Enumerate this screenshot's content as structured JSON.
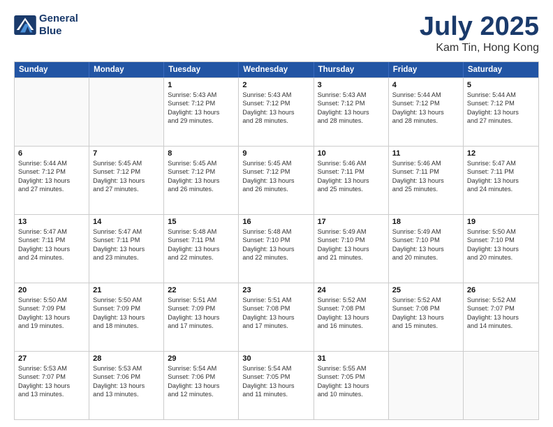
{
  "header": {
    "logo_line1": "General",
    "logo_line2": "Blue",
    "month": "July 2025",
    "location": "Kam Tin, Hong Kong"
  },
  "weekdays": [
    "Sunday",
    "Monday",
    "Tuesday",
    "Wednesday",
    "Thursday",
    "Friday",
    "Saturday"
  ],
  "rows": [
    [
      {
        "day": "",
        "lines": []
      },
      {
        "day": "",
        "lines": []
      },
      {
        "day": "1",
        "lines": [
          "Sunrise: 5:43 AM",
          "Sunset: 7:12 PM",
          "Daylight: 13 hours",
          "and 29 minutes."
        ]
      },
      {
        "day": "2",
        "lines": [
          "Sunrise: 5:43 AM",
          "Sunset: 7:12 PM",
          "Daylight: 13 hours",
          "and 28 minutes."
        ]
      },
      {
        "day": "3",
        "lines": [
          "Sunrise: 5:43 AM",
          "Sunset: 7:12 PM",
          "Daylight: 13 hours",
          "and 28 minutes."
        ]
      },
      {
        "day": "4",
        "lines": [
          "Sunrise: 5:44 AM",
          "Sunset: 7:12 PM",
          "Daylight: 13 hours",
          "and 28 minutes."
        ]
      },
      {
        "day": "5",
        "lines": [
          "Sunrise: 5:44 AM",
          "Sunset: 7:12 PM",
          "Daylight: 13 hours",
          "and 27 minutes."
        ]
      }
    ],
    [
      {
        "day": "6",
        "lines": [
          "Sunrise: 5:44 AM",
          "Sunset: 7:12 PM",
          "Daylight: 13 hours",
          "and 27 minutes."
        ]
      },
      {
        "day": "7",
        "lines": [
          "Sunrise: 5:45 AM",
          "Sunset: 7:12 PM",
          "Daylight: 13 hours",
          "and 27 minutes."
        ]
      },
      {
        "day": "8",
        "lines": [
          "Sunrise: 5:45 AM",
          "Sunset: 7:12 PM",
          "Daylight: 13 hours",
          "and 26 minutes."
        ]
      },
      {
        "day": "9",
        "lines": [
          "Sunrise: 5:45 AM",
          "Sunset: 7:12 PM",
          "Daylight: 13 hours",
          "and 26 minutes."
        ]
      },
      {
        "day": "10",
        "lines": [
          "Sunrise: 5:46 AM",
          "Sunset: 7:11 PM",
          "Daylight: 13 hours",
          "and 25 minutes."
        ]
      },
      {
        "day": "11",
        "lines": [
          "Sunrise: 5:46 AM",
          "Sunset: 7:11 PM",
          "Daylight: 13 hours",
          "and 25 minutes."
        ]
      },
      {
        "day": "12",
        "lines": [
          "Sunrise: 5:47 AM",
          "Sunset: 7:11 PM",
          "Daylight: 13 hours",
          "and 24 minutes."
        ]
      }
    ],
    [
      {
        "day": "13",
        "lines": [
          "Sunrise: 5:47 AM",
          "Sunset: 7:11 PM",
          "Daylight: 13 hours",
          "and 24 minutes."
        ]
      },
      {
        "day": "14",
        "lines": [
          "Sunrise: 5:47 AM",
          "Sunset: 7:11 PM",
          "Daylight: 13 hours",
          "and 23 minutes."
        ]
      },
      {
        "day": "15",
        "lines": [
          "Sunrise: 5:48 AM",
          "Sunset: 7:11 PM",
          "Daylight: 13 hours",
          "and 22 minutes."
        ]
      },
      {
        "day": "16",
        "lines": [
          "Sunrise: 5:48 AM",
          "Sunset: 7:10 PM",
          "Daylight: 13 hours",
          "and 22 minutes."
        ]
      },
      {
        "day": "17",
        "lines": [
          "Sunrise: 5:49 AM",
          "Sunset: 7:10 PM",
          "Daylight: 13 hours",
          "and 21 minutes."
        ]
      },
      {
        "day": "18",
        "lines": [
          "Sunrise: 5:49 AM",
          "Sunset: 7:10 PM",
          "Daylight: 13 hours",
          "and 20 minutes."
        ]
      },
      {
        "day": "19",
        "lines": [
          "Sunrise: 5:50 AM",
          "Sunset: 7:10 PM",
          "Daylight: 13 hours",
          "and 20 minutes."
        ]
      }
    ],
    [
      {
        "day": "20",
        "lines": [
          "Sunrise: 5:50 AM",
          "Sunset: 7:09 PM",
          "Daylight: 13 hours",
          "and 19 minutes."
        ]
      },
      {
        "day": "21",
        "lines": [
          "Sunrise: 5:50 AM",
          "Sunset: 7:09 PM",
          "Daylight: 13 hours",
          "and 18 minutes."
        ]
      },
      {
        "day": "22",
        "lines": [
          "Sunrise: 5:51 AM",
          "Sunset: 7:09 PM",
          "Daylight: 13 hours",
          "and 17 minutes."
        ]
      },
      {
        "day": "23",
        "lines": [
          "Sunrise: 5:51 AM",
          "Sunset: 7:08 PM",
          "Daylight: 13 hours",
          "and 17 minutes."
        ]
      },
      {
        "day": "24",
        "lines": [
          "Sunrise: 5:52 AM",
          "Sunset: 7:08 PM",
          "Daylight: 13 hours",
          "and 16 minutes."
        ]
      },
      {
        "day": "25",
        "lines": [
          "Sunrise: 5:52 AM",
          "Sunset: 7:08 PM",
          "Daylight: 13 hours",
          "and 15 minutes."
        ]
      },
      {
        "day": "26",
        "lines": [
          "Sunrise: 5:52 AM",
          "Sunset: 7:07 PM",
          "Daylight: 13 hours",
          "and 14 minutes."
        ]
      }
    ],
    [
      {
        "day": "27",
        "lines": [
          "Sunrise: 5:53 AM",
          "Sunset: 7:07 PM",
          "Daylight: 13 hours",
          "and 13 minutes."
        ]
      },
      {
        "day": "28",
        "lines": [
          "Sunrise: 5:53 AM",
          "Sunset: 7:06 PM",
          "Daylight: 13 hours",
          "and 13 minutes."
        ]
      },
      {
        "day": "29",
        "lines": [
          "Sunrise: 5:54 AM",
          "Sunset: 7:06 PM",
          "Daylight: 13 hours",
          "and 12 minutes."
        ]
      },
      {
        "day": "30",
        "lines": [
          "Sunrise: 5:54 AM",
          "Sunset: 7:05 PM",
          "Daylight: 13 hours",
          "and 11 minutes."
        ]
      },
      {
        "day": "31",
        "lines": [
          "Sunrise: 5:55 AM",
          "Sunset: 7:05 PM",
          "Daylight: 13 hours",
          "and 10 minutes."
        ]
      },
      {
        "day": "",
        "lines": []
      },
      {
        "day": "",
        "lines": []
      }
    ]
  ]
}
